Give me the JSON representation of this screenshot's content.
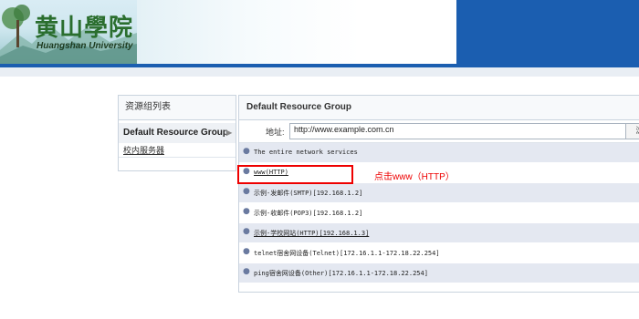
{
  "header": {
    "logo_cn": "黄山學院",
    "logo_en": "Huangshan University"
  },
  "sidebar": {
    "title": "资源组列表",
    "items": [
      {
        "label": "Default Resource Group",
        "active": true
      },
      {
        "label": "校内服务器",
        "active": false
      }
    ]
  },
  "main": {
    "title": "Default Resource Group",
    "address_label": "地址:",
    "address_value": "http://www.example.com.cn",
    "go_label": "浏",
    "resources": [
      {
        "label": "The entire network services",
        "link": false
      },
      {
        "label": "www(HTTP)",
        "link": true
      },
      {
        "label": "示例-发邮件(SMTP)[192.168.1.2]",
        "link": false
      },
      {
        "label": "示例-收邮件(POP3)[192.168.1.2]",
        "link": false
      },
      {
        "label": "示例-学校网站(HTTP)[192.168.1.3]",
        "link": true
      },
      {
        "label": "telnet宿舍网设备(Telnet)[172.16.1.1-172.18.22.254]",
        "link": false
      },
      {
        "label": "ping宿舍网设备(Other)[172.16.1.1-172.18.22.254]",
        "link": false
      }
    ]
  },
  "annotation": {
    "text": "点击www（HTTP）",
    "color": "#ee0000"
  },
  "colors": {
    "brand_blue": "#1b5eb0",
    "row_shade": "#e4e8f1"
  }
}
